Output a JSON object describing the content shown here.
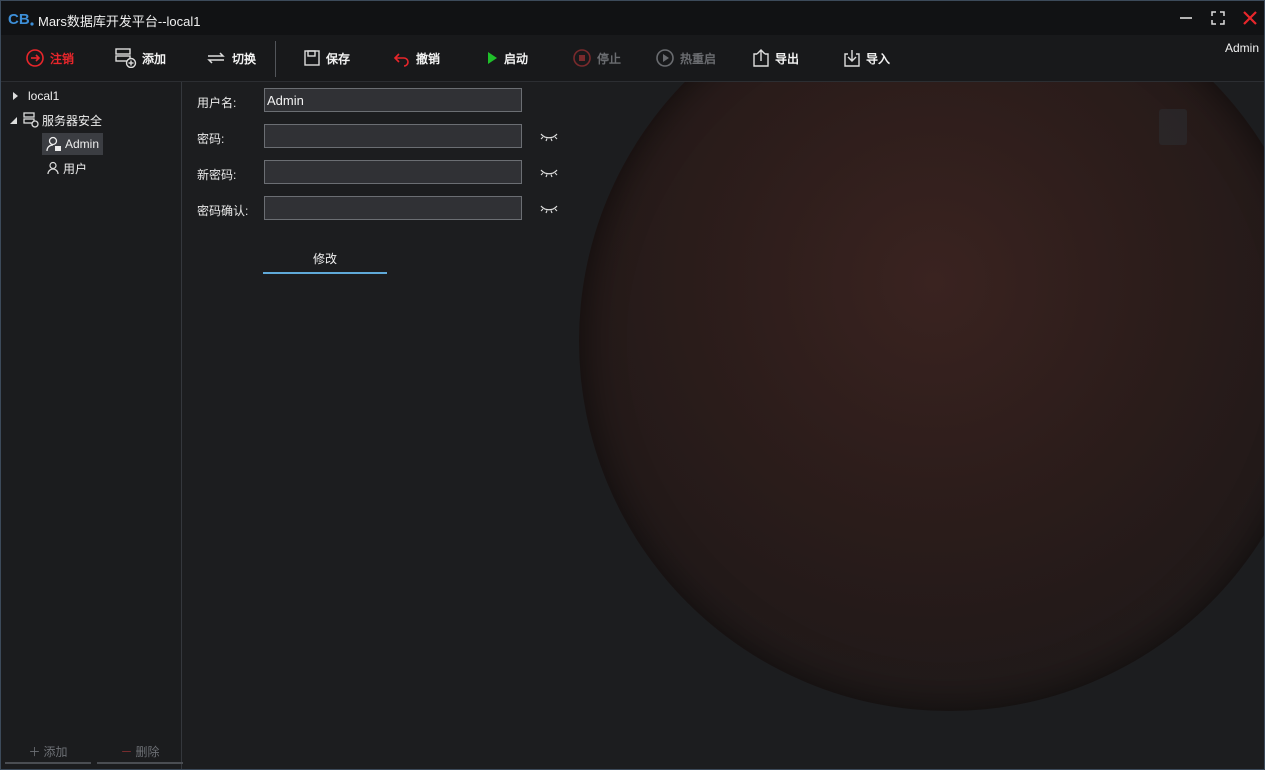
{
  "window": {
    "title": "Mars数据库开发平台--local1"
  },
  "toolbar": {
    "logout": "注销",
    "add": "添加",
    "switch": "切换",
    "save": "保存",
    "revoke": "撤销",
    "start": "启动",
    "stop": "停止",
    "hot_restart": "热重启",
    "export": "导出",
    "import": "导入",
    "current_user": "Admin"
  },
  "tree": {
    "root": "local1",
    "group": "服务器安全",
    "items": [
      "Admin",
      "用户"
    ],
    "add_button": "添加",
    "delete_button": "删除"
  },
  "form": {
    "username_label": "用户名:",
    "username_value": "Admin",
    "password_label": "密码:",
    "new_password_label": "新密码:",
    "confirm_password_label": "密码确认:",
    "modify_button": "修改"
  },
  "colors": {
    "accent_red": "#e8262b",
    "start_green": "#1fbf2a",
    "modify_underline": "#5fa9d8"
  }
}
